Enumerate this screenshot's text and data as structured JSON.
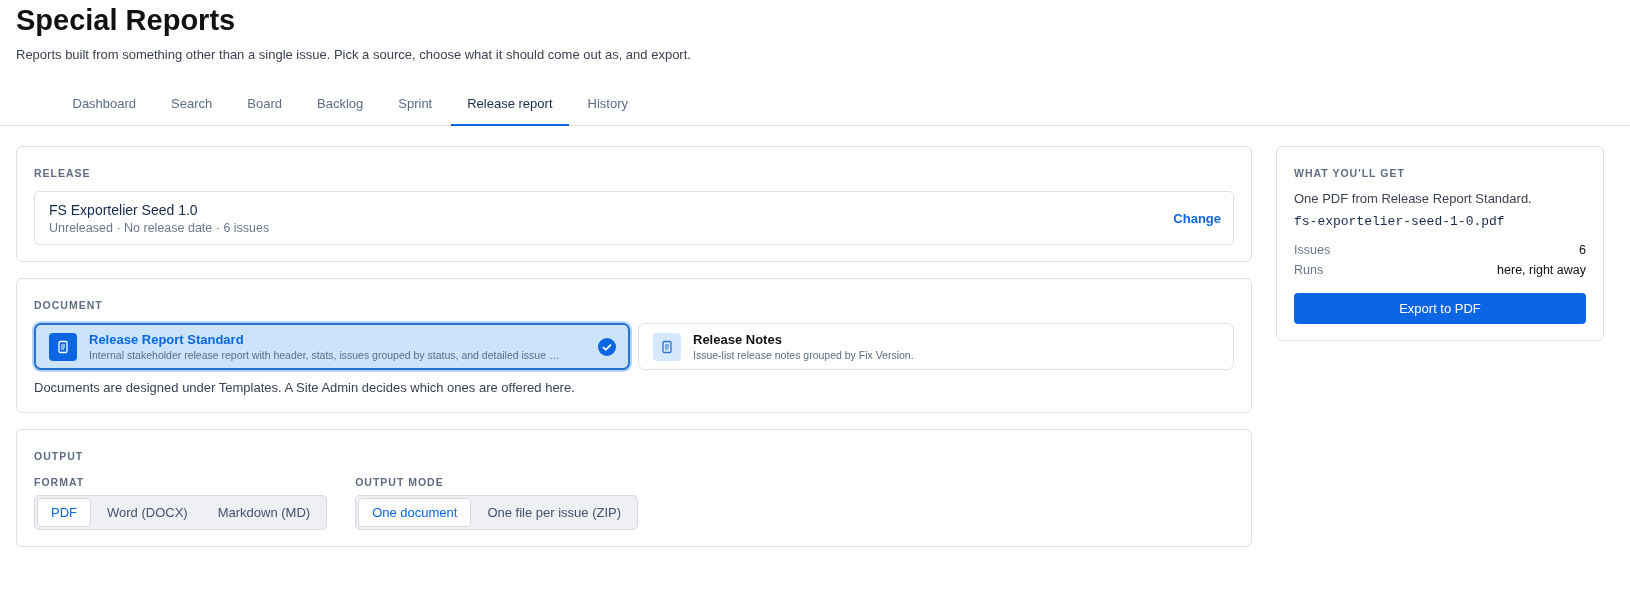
{
  "page": {
    "title": "Special Reports",
    "subtitle": "Reports built from something other than a single issue. Pick a source, choose what it should come out as, and export."
  },
  "tabs": [
    {
      "label": "Dashboard",
      "selected": false
    },
    {
      "label": "Search",
      "selected": false
    },
    {
      "label": "Board",
      "selected": false
    },
    {
      "label": "Backlog",
      "selected": false
    },
    {
      "label": "Sprint",
      "selected": false
    },
    {
      "label": "Release report",
      "selected": true
    },
    {
      "label": "History",
      "selected": false
    }
  ],
  "release": {
    "heading": "RELEASE",
    "name": "FS Exportelier Seed 1.0",
    "meta": "Unreleased · No release date · 6 issues",
    "action": "Change"
  },
  "document": {
    "heading": "DOCUMENT",
    "options": [
      {
        "title": "Release Report Standard",
        "description": "Internal stakeholder release report with header, stats, issues grouped by status, and detailed issue …",
        "selected": true
      },
      {
        "title": "Release Notes",
        "description": "Issue-list release notes grouped by Fix Version.",
        "selected": false
      }
    ],
    "note": "Documents are designed under Templates. A Site Admin decides which ones are offered here."
  },
  "output": {
    "heading": "OUTPUT",
    "groups": [
      {
        "label": "FORMAT",
        "options": [
          {
            "label": "PDF",
            "selected": true
          },
          {
            "label": "Word (DOCX)",
            "selected": false
          },
          {
            "label": "Markdown (MD)",
            "selected": false
          }
        ]
      },
      {
        "label": "OUTPUT MODE",
        "options": [
          {
            "label": "One document",
            "selected": true
          },
          {
            "label": "One file per issue (ZIP)",
            "selected": false
          }
        ]
      }
    ]
  },
  "summary": {
    "heading": "WHAT YOU'LL GET",
    "line": "One PDF from Release Report Standard.",
    "filename": "fs-exportelier-seed-1-0.pdf",
    "rows": [
      {
        "label": "Issues",
        "value": "6"
      },
      {
        "label": "Runs",
        "value": "here, right away"
      }
    ],
    "button": "Export to PDF"
  }
}
